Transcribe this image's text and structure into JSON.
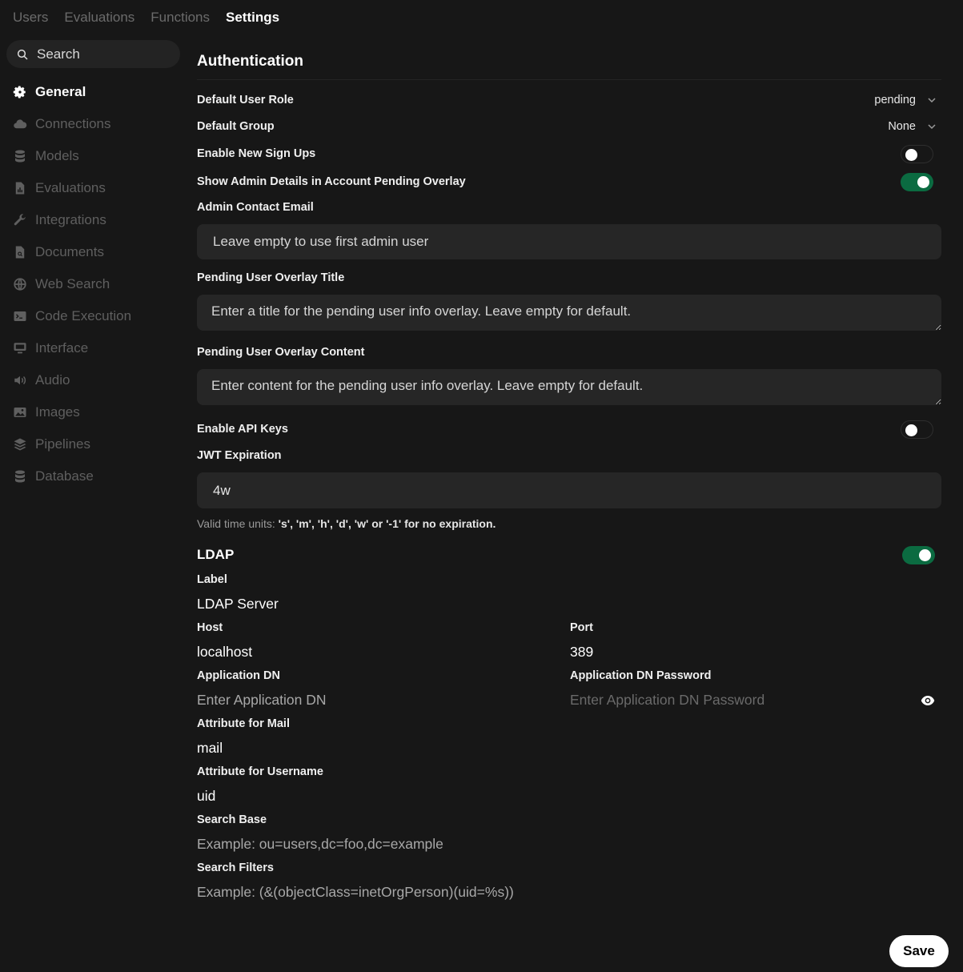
{
  "top_tabs": [
    "Users",
    "Evaluations",
    "Functions",
    "Settings"
  ],
  "search": {
    "placeholder": "Search"
  },
  "sidebar": {
    "items": [
      {
        "label": "General",
        "icon": "gear-icon"
      },
      {
        "label": "Connections",
        "icon": "cloud-icon"
      },
      {
        "label": "Models",
        "icon": "database-stack-icon"
      },
      {
        "label": "Evaluations",
        "icon": "document-chart-icon"
      },
      {
        "label": "Integrations",
        "icon": "wrench-icon"
      },
      {
        "label": "Documents",
        "icon": "document-search-icon"
      },
      {
        "label": "Web Search",
        "icon": "globe-icon"
      },
      {
        "label": "Code Execution",
        "icon": "terminal-icon"
      },
      {
        "label": "Interface",
        "icon": "monitor-icon"
      },
      {
        "label": "Audio",
        "icon": "speaker-icon"
      },
      {
        "label": "Images",
        "icon": "image-icon"
      },
      {
        "label": "Pipelines",
        "icon": "layers-icon"
      },
      {
        "label": "Database",
        "icon": "database-icon"
      }
    ]
  },
  "auth": {
    "title": "Authentication",
    "default_user_role": {
      "label": "Default User Role",
      "value": "pending"
    },
    "default_group": {
      "label": "Default Group",
      "value": "None"
    },
    "enable_signups": {
      "label": "Enable New Sign Ups",
      "on": false
    },
    "show_admin_details": {
      "label": "Show Admin Details in Account Pending Overlay",
      "on": true
    },
    "admin_email": {
      "label": "Admin Contact Email",
      "placeholder": "Leave empty to use first admin user"
    },
    "overlay_title": {
      "label": "Pending User Overlay Title",
      "placeholder": "Enter a title for the pending user info overlay. Leave empty for default."
    },
    "overlay_content": {
      "label": "Pending User Overlay Content",
      "placeholder": "Enter content for the pending user info overlay. Leave empty for default."
    },
    "enable_api_keys": {
      "label": "Enable API Keys",
      "on": false
    },
    "jwt": {
      "label": "JWT Expiration",
      "value": "4w",
      "hint_prefix": "Valid time units:",
      "hint_units": "'s', 'm', 'h', 'd', 'w' or '-1' for no expiration."
    }
  },
  "ldap": {
    "title": "LDAP",
    "on": true,
    "label": {
      "label": "Label",
      "value": "LDAP Server"
    },
    "host": {
      "label": "Host",
      "value": "localhost"
    },
    "port": {
      "label": "Port",
      "value": "389"
    },
    "app_dn": {
      "label": "Application DN",
      "placeholder": "Enter Application DN"
    },
    "app_dn_password": {
      "label": "Application DN Password",
      "placeholder": "Enter Application DN Password"
    },
    "attr_mail": {
      "label": "Attribute for Mail",
      "value": "mail"
    },
    "attr_username": {
      "label": "Attribute for Username",
      "value": "uid"
    },
    "search_base": {
      "label": "Search Base",
      "placeholder": "Example: ou=users,dc=foo,dc=example"
    },
    "search_filters": {
      "label": "Search Filters",
      "placeholder": "Example: (&(objectClass=inetOrgPerson)(uid=%s))"
    }
  },
  "save_label": "Save",
  "colors": {
    "background": "#171717",
    "toggle_on": "#0b6b41",
    "field": "#262626"
  }
}
